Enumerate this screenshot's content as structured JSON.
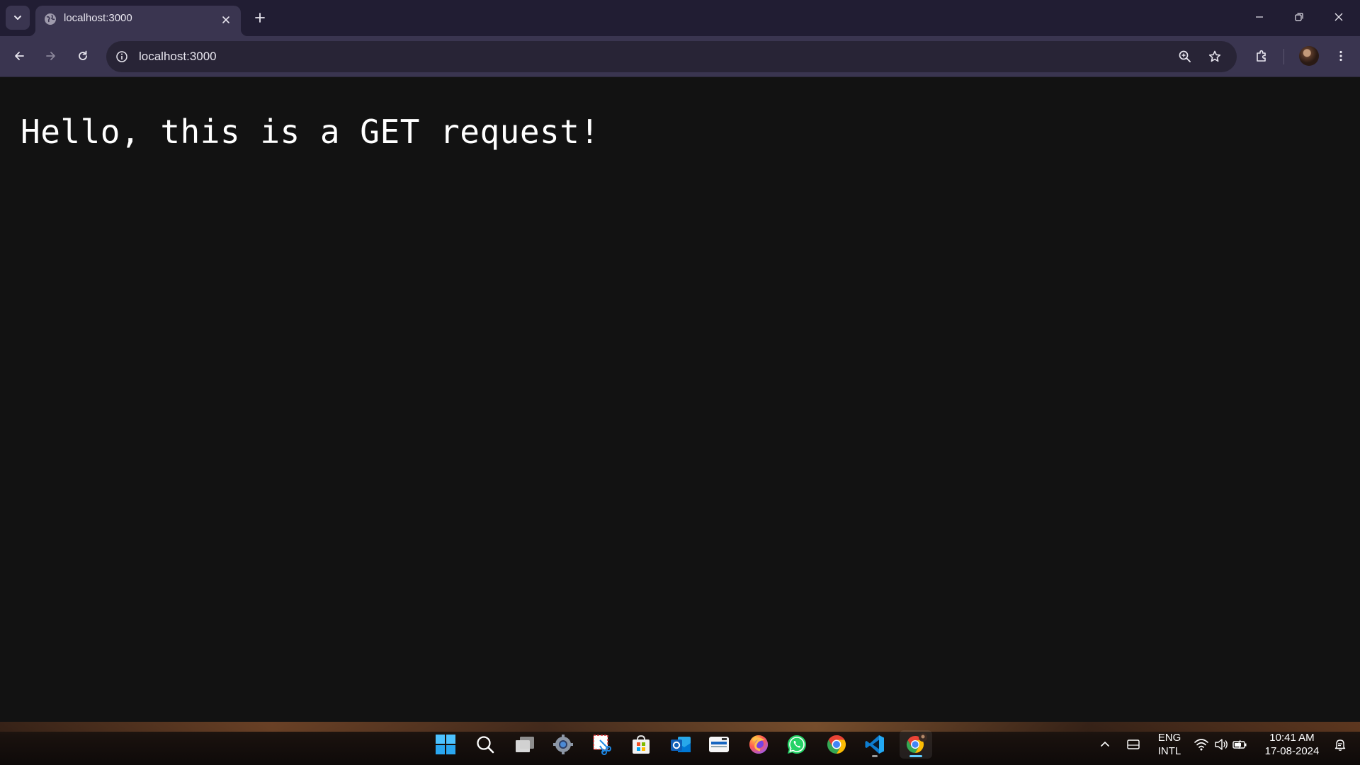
{
  "browser": {
    "tab": {
      "title": "localhost:3000"
    },
    "address_bar": {
      "url": "localhost:3000"
    }
  },
  "page": {
    "body_text": "Hello, this is a GET request!"
  },
  "taskbar": {
    "apps": [
      {
        "name": "start-icon"
      },
      {
        "name": "search-icon"
      },
      {
        "name": "task-view-icon"
      },
      {
        "name": "settings-icon"
      },
      {
        "name": "snipping-tool-icon"
      },
      {
        "name": "microsoft-store-icon"
      },
      {
        "name": "outlook-icon"
      },
      {
        "name": "scanner-app-icon"
      },
      {
        "name": "firefox-icon"
      },
      {
        "name": "whatsapp-icon"
      },
      {
        "name": "chrome-icon"
      },
      {
        "name": "vscode-icon"
      },
      {
        "name": "chrome-profile-icon"
      }
    ],
    "tray": {
      "language_line1": "ENG",
      "language_line2": "INTL",
      "time": "10:41 AM",
      "date": "17-08-2024"
    }
  },
  "colors": {
    "tabstrip_bg": "#211d33",
    "toolbar_bg": "#3a3550",
    "page_bg": "#121212",
    "page_text": "#ffffff"
  }
}
